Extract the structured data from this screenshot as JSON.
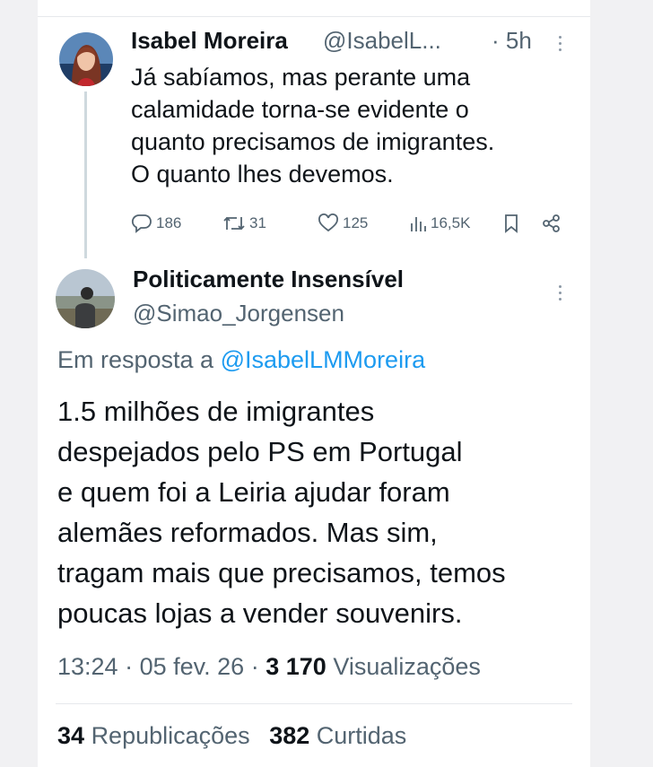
{
  "reply_parent": {
    "author_name": "Isabel Moreira",
    "author_handle": "@IsabelL...",
    "time": "· 5h",
    "text_lines": [
      "Já sabíamos, mas perante uma",
      "calamidade torna-se evidente o",
      "quanto precisamos de imigrantes.",
      "O quanto lhes devemos."
    ],
    "actions": {
      "replies": "186",
      "reposts": "31",
      "likes": "125",
      "views": "16,5K"
    }
  },
  "main_tweet": {
    "author_name": "Politicamente Insensível",
    "author_handle": "@Simao_Jorgensen",
    "reply_to_prefix": "Em resposta a",
    "reply_to_handle": "@IsabelLMMoreira",
    "text_lines": [
      "1.5 milhões de imigrantes",
      "despejados pelo PS em Portugal",
      "e quem foi a Leiria ajudar foram",
      "alemães reformados. Mas sim,",
      "tragam mais que precisamos, temos",
      "poucas lojas a vender souvenirs."
    ],
    "meta": {
      "time": "13:24",
      "date": "05 fev. 26",
      "dot": "·",
      "views_count": "3 170",
      "views_label": "Visualizações"
    },
    "stats": {
      "reposts_count": "34",
      "reposts_label": "Republicações",
      "likes_count": "382",
      "likes_label": "Curtidas"
    }
  },
  "icons": [
    "reply-icon",
    "repost-icon",
    "like-icon",
    "views-icon",
    "bookmark-icon",
    "share-icon",
    "more-options-icon"
  ],
  "colors": {
    "link": "#1d9bf0",
    "secondary_text": "#536471",
    "thread_line": "#cfd9de"
  }
}
